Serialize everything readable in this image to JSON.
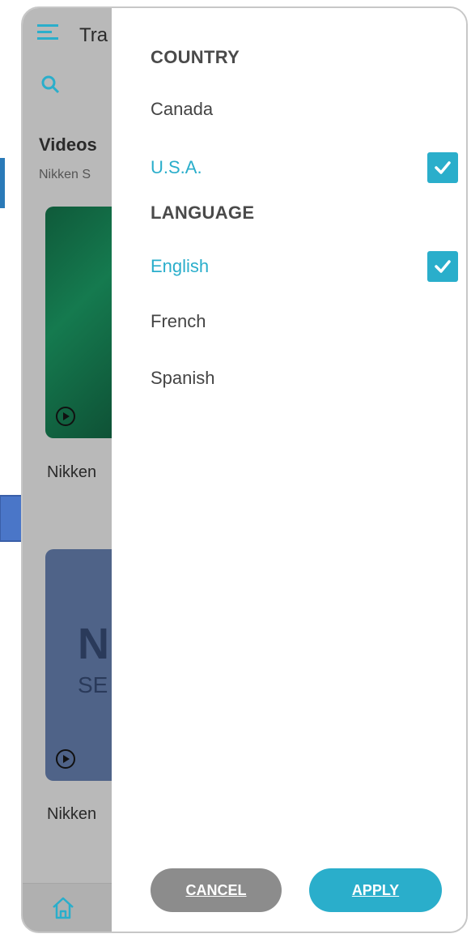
{
  "background_app": {
    "title": "Tra",
    "section_title": "Videos",
    "section_subtitle": "Nikken S",
    "card1_caption": "Nikken",
    "card2_big_text": "N",
    "card2_small_text": "SE",
    "card2_caption": "Nikken"
  },
  "filter": {
    "country_header": "COUNTRY",
    "country_options": [
      {
        "label": "Canada",
        "selected": false
      },
      {
        "label": "U.S.A.",
        "selected": true
      }
    ],
    "language_header": "LANGUAGE",
    "language_options": [
      {
        "label": "English",
        "selected": true
      },
      {
        "label": "French",
        "selected": false
      },
      {
        "label": "Spanish",
        "selected": false
      }
    ],
    "cancel_label": "CANCEL",
    "apply_label": "APPLY"
  },
  "colors": {
    "accent": "#2aaecb",
    "cancel_button": "#8c8c8c",
    "overlay": "#b9b9b9"
  },
  "icons": {
    "menu": "hamburger-icon",
    "search": "search-icon",
    "play": "play-circle-icon",
    "home": "home-icon",
    "check": "checkmark-icon",
    "arrow": "right-arrow-shape"
  }
}
